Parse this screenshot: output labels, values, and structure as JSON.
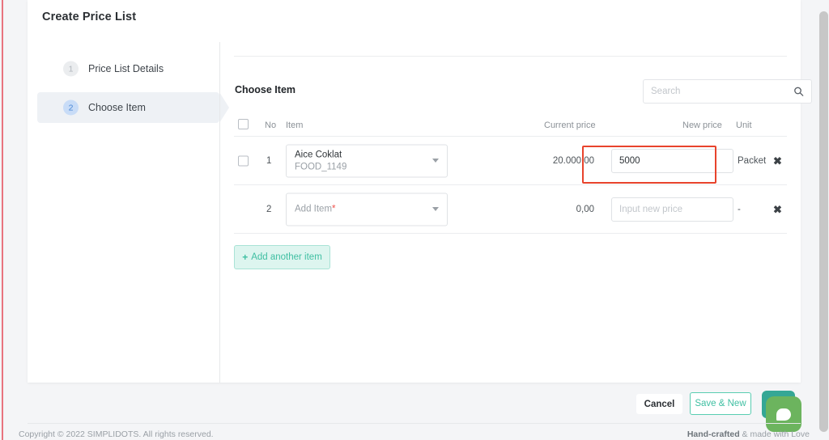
{
  "window": {
    "title": "Create Price List"
  },
  "stepper": {
    "steps": [
      {
        "num": "1",
        "label": "Price List Details",
        "active": false
      },
      {
        "num": "2",
        "label": "Choose Item",
        "active": true
      }
    ]
  },
  "content": {
    "section_title": "Choose Item",
    "search": {
      "placeholder": "Search",
      "value": ""
    },
    "table": {
      "headers": {
        "no": "No",
        "item": "Item",
        "current_price": "Current price",
        "new_price": "New price",
        "unit": "Unit"
      },
      "rows": [
        {
          "no": "1",
          "item_name": "Aice Coklat",
          "item_code": "FOOD_1149",
          "item_placeholder": "",
          "current_price": "20.000,00",
          "new_price_value": "5000",
          "new_price_placeholder": "",
          "unit": "Packet",
          "delete_icon": "close-icon",
          "highlighted": true
        },
        {
          "no": "2",
          "item_name": "",
          "item_code": "",
          "item_placeholder": "Add Item",
          "required_marker": "*",
          "current_price": "0,00",
          "new_price_value": "",
          "new_price_placeholder": "Input new price",
          "unit": "-",
          "delete_icon": "close-icon",
          "highlighted": false
        }
      ]
    },
    "add_another_item": {
      "plus": "+",
      "label": "Add another item"
    }
  },
  "footer": {
    "cancel_label": "Cancel",
    "save_new_label": "Save & New",
    "copyright": "Copyright © 2022 SIMPLIDOTS. All rights reserved.",
    "handcrafted_bold": "Hand-crafted",
    "handcrafted_rest": " & made with Love",
    "chat_icon": "chat-bubble-icon"
  },
  "colors": {
    "accent_teal": "#3fbfa2",
    "annotation_red": "#e8432c",
    "step_active_blue": "#4b88d6",
    "chat_green": "#6cb45e"
  }
}
